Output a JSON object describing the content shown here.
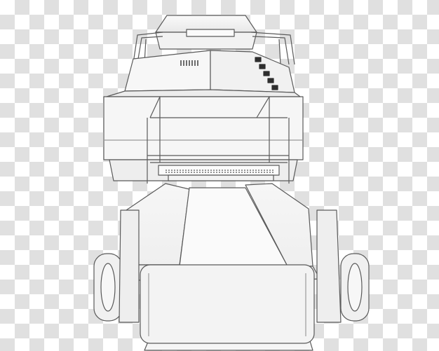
{
  "image": {
    "background": "transparency-checkerboard",
    "colors": {
      "checker_light": "#ffffff",
      "checker_dark": "#e0e0e0",
      "body_fill": "#f4f4f4",
      "body_shade": "#e6e6e6",
      "outline": "#5a5a5a",
      "vent": "#333333"
    }
  }
}
